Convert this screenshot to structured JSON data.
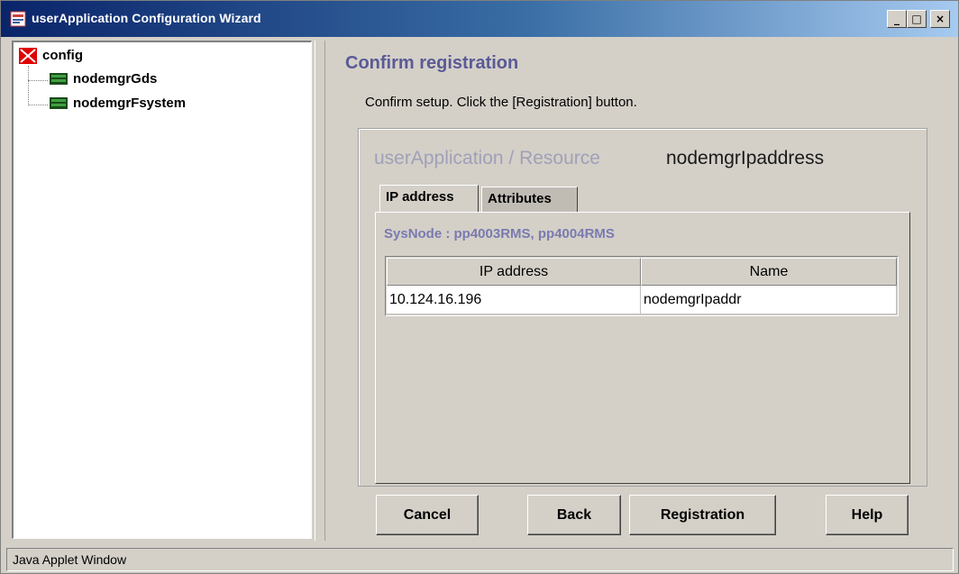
{
  "window": {
    "title": "userApplication Configuration Wizard",
    "controls": {
      "minimize": "_",
      "maximize": "□",
      "close": "×"
    }
  },
  "tree": {
    "root": {
      "label": "config",
      "icon": "config-icon"
    },
    "children": [
      {
        "label": "nodemgrGds",
        "icon": "resource-icon"
      },
      {
        "label": "nodemgrFsystem",
        "icon": "resource-icon"
      }
    ]
  },
  "main": {
    "heading": "Confirm registration",
    "instruction": "Confirm setup.  Click the [Registration] button.",
    "resource_label": "userApplication / Resource",
    "resource_value": "nodemgrIpaddress",
    "tabs": [
      {
        "label": "IP address",
        "active": true
      },
      {
        "label": "Attributes",
        "active": false
      }
    ],
    "sysnode": "SysNode : pp4003RMS, pp4004RMS",
    "table": {
      "columns": [
        "IP address",
        "Name"
      ],
      "rows": [
        [
          "10.124.16.196",
          "nodemgrIpaddr"
        ]
      ]
    }
  },
  "buttons": {
    "cancel": "Cancel",
    "back": "Back",
    "registration": "Registration",
    "help": "Help"
  },
  "status": "Java Applet Window",
  "colors": {
    "titlebar_start": "#0a246a",
    "titlebar_end": "#a6caf0",
    "heading": "#5a5a96",
    "sysnode": "#7a7ab0",
    "background": "#d4d0c8"
  }
}
